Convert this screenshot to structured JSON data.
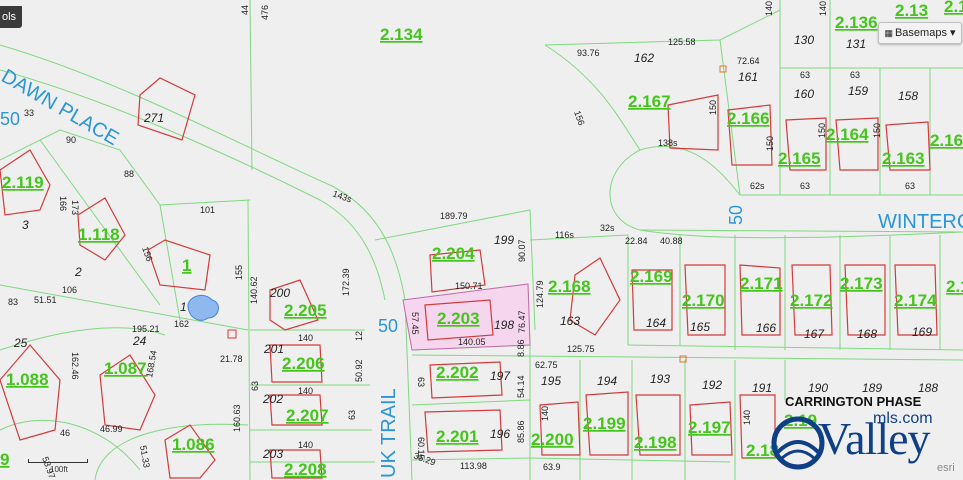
{
  "toolbar": {
    "tools_label": "ols",
    "basemaps_label": "Basemaps ▾"
  },
  "scale": {
    "label": "100ft"
  },
  "branding": {
    "logo_text": "Valley",
    "logo_domain": "mls.com",
    "attribution": "esri"
  },
  "colors": {
    "parcel_line": "#7fd97f",
    "building": "#d23b3b",
    "parcel_id": "#46c41e",
    "road_label": "#2b96d6",
    "selected_fill": "#f5d6ee",
    "water": "#3d86d8"
  },
  "roads": [
    {
      "name": "DAWN PLACE",
      "type": "street"
    },
    {
      "name": "WINTERC",
      "type": "street"
    },
    {
      "name": "UK TRAIL",
      "type": "street"
    },
    {
      "name": "50",
      "type": "route-number"
    },
    {
      "name": "50",
      "type": "route-number"
    },
    {
      "name": "50",
      "type": "route-number"
    }
  ],
  "subdivision": "CARRINGTON PHASE",
  "parcel_ids": [
    "2.134",
    "2.167",
    "2.166",
    "2.164",
    "2.165",
    "2.163",
    "2.16",
    "2.136",
    "2.13",
    "2.119",
    "1.118",
    "1",
    "2.204",
    "2.205",
    "2.168",
    "2.169",
    "2.170",
    "2.171",
    "2.172",
    "2.173",
    "2.174",
    "2.1",
    "2.203",
    "2.206",
    "2.202",
    "2.207",
    "1.088",
    "1.087",
    "1.086",
    "2.201",
    "2.200",
    "2.199",
    "2.198",
    "2.197",
    "2.208",
    "2.19",
    "2.18",
    "9",
    "2.16"
  ],
  "lot_numbers": [
    "130",
    "131",
    "162",
    "161",
    "160",
    "159",
    "158",
    "199",
    "198",
    "197",
    "196",
    "195",
    "194",
    "193",
    "192",
    "191",
    "190",
    "189",
    "188",
    "200",
    "201",
    "202",
    "203",
    "164",
    "165",
    "166",
    "167",
    "168",
    "169",
    "163",
    "2",
    "3",
    "25",
    "24",
    "271",
    "1"
  ],
  "dimensions": [
    "93.76",
    "125.58",
    "72.64",
    "156",
    "138s",
    "62s",
    "63",
    "63",
    "63",
    "63",
    "140",
    "140",
    "150",
    "150",
    "150",
    "150",
    "143s",
    "189.79",
    "116s",
    "32s",
    "22.84",
    "40.88",
    "90.07",
    "124.79",
    "150.71",
    "57.45",
    "76.47",
    "140.05",
    "125.75",
    "62.75",
    "8.86",
    "54.14",
    "85.86",
    "60.15",
    "35.29",
    "113.98",
    "63.9",
    "155",
    "140.62",
    "172.39",
    "50.92",
    "12",
    "160.63",
    "101",
    "88",
    "90",
    "33",
    "166",
    "173",
    "156",
    "106",
    "51.51",
    "162",
    "195.21",
    "21.78",
    "162.46",
    "168.54",
    "46.99",
    "51.33",
    "53.97",
    "46",
    "83",
    "140",
    "140",
    "140",
    "140",
    "44",
    "476",
    "140",
    "63",
    "63",
    "63"
  ]
}
